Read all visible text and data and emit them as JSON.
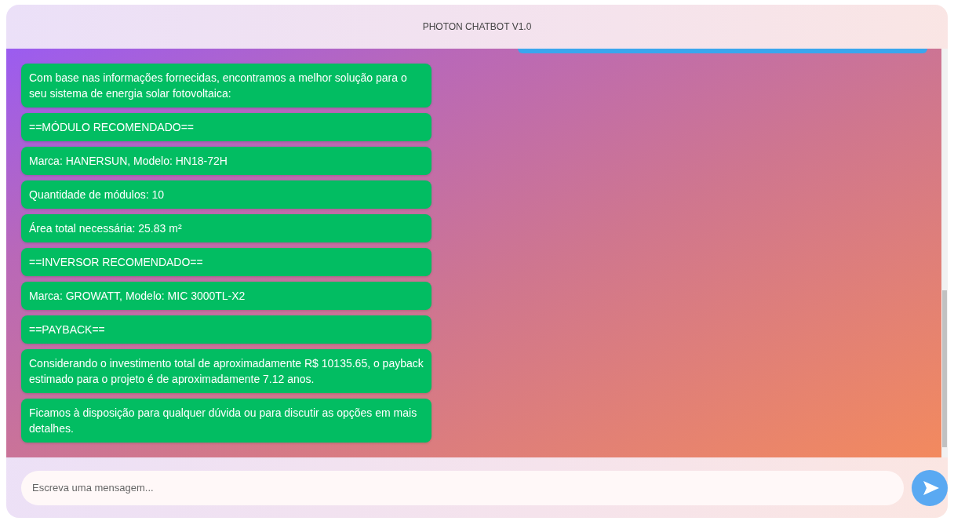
{
  "header": {
    "title": "PHOTON CHATBOT V1.0"
  },
  "messages": [
    {
      "kind": "user"
    },
    {
      "kind": "bot",
      "text": "Com base nas informações fornecidas, encontramos a melhor solução para o seu sistema de energia solar fotovoltaica:"
    },
    {
      "kind": "bot",
      "text": "==MÓDULO RECOMENDADO=="
    },
    {
      "kind": "bot",
      "text": "Marca: HANERSUN, Modelo: HN18-72H"
    },
    {
      "kind": "bot",
      "text": "Quantidade de módulos: 10"
    },
    {
      "kind": "bot",
      "text": "Área total necessária: 25.83 m²"
    },
    {
      "kind": "bot",
      "text": "==INVERSOR RECOMENDADO=="
    },
    {
      "kind": "bot",
      "text": "Marca: GROWATT, Modelo: MIC 3000TL-X2"
    },
    {
      "kind": "bot",
      "text": "==PAYBACK=="
    },
    {
      "kind": "bot",
      "text": "Considerando o investimento total de aproximadamente R$ 10135.65, o payback estimado para o projeto é de aproximadamente 7.12 anos."
    },
    {
      "kind": "bot",
      "text": "Ficamos à disposição para qualquer dúvida ou para discutir as opções em mais detalhes."
    }
  ],
  "composer": {
    "placeholder": "Escreva uma mensagem..."
  }
}
